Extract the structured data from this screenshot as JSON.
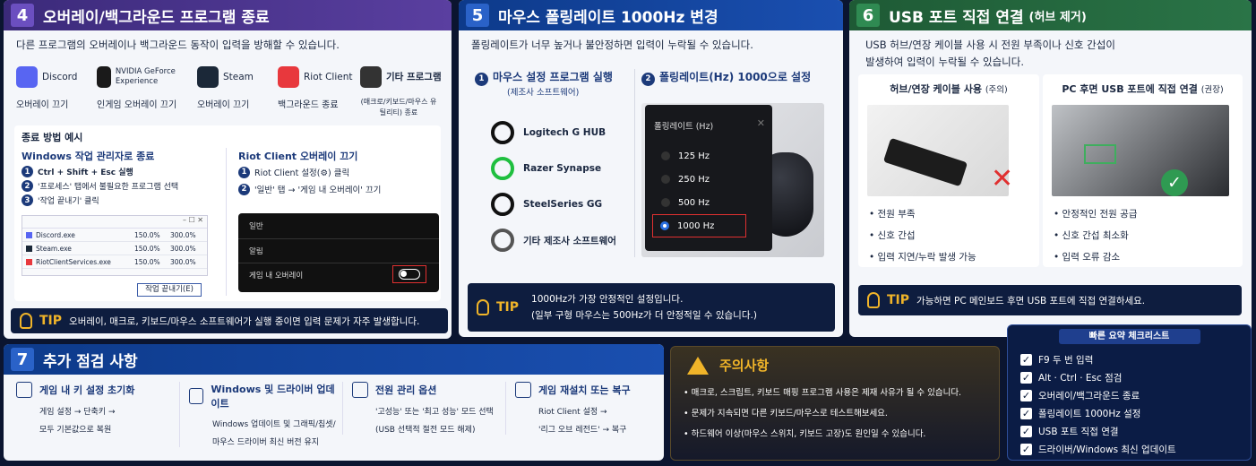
{
  "p4": {
    "num": "4",
    "title": "오버레이/백그라운드 프로그램 종료",
    "sub": "다른 프로그램의 오버레이나 백그라운드 동작이 입력을 방해할 수 있습니다.",
    "apps": [
      {
        "name": "Discord",
        "label": "오버레이 끄기",
        "color": "#5865f2"
      },
      {
        "name": "NVIDIA GeForce Experience",
        "label": "인게임 오버레이 끄기",
        "color": "#1a1a1a"
      },
      {
        "name": "Steam",
        "label": "오버레이 끄기",
        "color": "#1b2838"
      },
      {
        "name": "Riot Client",
        "label": "백그라운드 종료",
        "color": "#e8383d"
      },
      {
        "name": "기타 프로그램",
        "label": "(매크로/키보드/마우스 유틸리티) 종료",
        "color": "#333"
      }
    ],
    "example": "종료 방법 예시",
    "win_title": "Windows 작업 관리자로 종료",
    "win_steps": [
      "Ctrl + Shift + Esc 실행",
      "'프로세스' 탭에서 불필요한 프로그램 선택",
      "'작업 끝내기' 클릭"
    ],
    "procs": [
      {
        "name": "Discord.exe",
        "cpu": "150.0%",
        "mem": "300.0%"
      },
      {
        "name": "Steam.exe",
        "cpu": "150.0%",
        "mem": "300.0%"
      },
      {
        "name": "RiotClientServices.exe",
        "cpu": "150.0%",
        "mem": "300.0%"
      }
    ],
    "end_task": "작업 끝내기(E)",
    "riot_title": "Riot Client 오버레이 끄기",
    "riot_steps": [
      "Riot Client 설정(⚙) 클릭",
      "'일반' 탭 → '게임 내 오버레이' 끄기"
    ],
    "riot_menu": [
      "일반",
      "알림",
      "게임 내 오버레이"
    ],
    "tip_word": "TIP",
    "tip": "오버레이, 매크로, 키보드/마우스 소프트웨어가 실행 중이면 입력 문제가 자주 발생합니다."
  },
  "p5": {
    "num": "5",
    "title": "마우스 폴링레이트 1000Hz 변경",
    "sub": "폴링레이트가 너무 높거나 불안정하면 입력이 누락될 수 있습니다.",
    "step1": "마우스 설정 프로그램 실행",
    "step1_sub": "(제조사 소프트웨어)",
    "step2": "폴링레이트(Hz) 1000으로 설정",
    "softs": [
      "Logitech G HUB",
      "Razer Synapse",
      "SteelSeries GG",
      "기타 제조사 소프트웨어"
    ],
    "dialog_title": "폴링레이트 (Hz)",
    "rates": [
      "125 Hz",
      "250 Hz",
      "500 Hz",
      "1000 Hz"
    ],
    "tip_word": "TIP",
    "tip1": "1000Hz가 가장 안정적인 설정입니다.",
    "tip2": "(일부 구형 마우스는 500Hz가 더 안정적일 수 있습니다.)"
  },
  "p6": {
    "num": "6",
    "title": "USB 포트 직접 연결",
    "title_sub": "(허브 제거)",
    "sub1": "USB 허브/연장 케이블 사용 시 전원 부족이나 신호 간섭이",
    "sub2": "발생하여 입력이 누락될 수 있습니다.",
    "left_title": "허브/연장 케이블 사용",
    "left_note": "(주의)",
    "right_title": "PC 후면 USB 포트에 직접 연결",
    "right_note": "(권장)",
    "left_bullets": [
      "전원 부족",
      "신호 간섭",
      "입력 지연/누락 발생 가능"
    ],
    "right_bullets": [
      "안정적인 전원 공급",
      "신호 간섭 최소화",
      "입력 오류 감소"
    ],
    "tip_word": "TIP",
    "tip": "가능하면 PC 메인보드 후면 USB 포트에 직접 연결하세요."
  },
  "p7": {
    "num": "7",
    "title": "추가 점검 사항",
    "items": [
      {
        "title": "게임 내 키 설정 초기화",
        "l1": "게임 설정 → 단축키 →",
        "l2": "모두 기본값으로 복원"
      },
      {
        "title": "Windows 및 드라이버 업데이트",
        "l1": "Windows 업데이트 및 그래픽/칩셋/",
        "l2": "마우스 드라이버 최신 버전 유지"
      },
      {
        "title": "전원 관리 옵션",
        "l1": "'고성능' 또는 '최고 성능' 모드 선택",
        "l2": "(USB 선택적 절전 모드 해제)"
      },
      {
        "title": "게임 재설치 또는 복구",
        "l1": "Riot Client 설정 →",
        "l2": "'리그 오브 레전드' → 복구"
      }
    ]
  },
  "caution": {
    "title": "주의사항",
    "items": [
      "매크로, 스크립트, 키보드 매핑 프로그램 사용은 제재 사유가 될 수 있습니다.",
      "문제가 지속되면 다른 키보드/마우스로 테스트해보세요.",
      "하드웨어 이상(마우스 스위치, 키보드 고장)도 원인일 수 있습니다."
    ]
  },
  "checklist": {
    "title": "빠른 요약 체크리스트",
    "items": [
      "F9 두 번 입력",
      "Alt · Ctrl · Esc 점검",
      "오버레이/백그라운드 종료",
      "폴링레이트 1000Hz 설정",
      "USB 포트 직접 연결",
      "드라이버/Windows 최신 업데이트"
    ]
  },
  "colors": {
    "p4": "#3b2a7a",
    "p5": "#0d3a8a",
    "p6": "#1e5a35",
    "p7": "#0d3a8a"
  }
}
